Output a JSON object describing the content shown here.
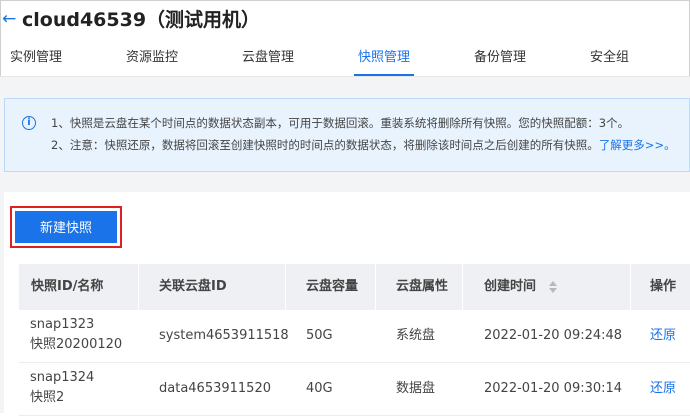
{
  "header": {
    "back_icon": "back-arrow-icon",
    "back_glyph": "←",
    "title": "cloud46539（测试用机）"
  },
  "tabs": [
    {
      "label": "实例管理",
      "active": false
    },
    {
      "label": "资源监控",
      "active": false
    },
    {
      "label": "云盘管理",
      "active": false
    },
    {
      "label": "快照管理",
      "active": true
    },
    {
      "label": "备份管理",
      "active": false
    },
    {
      "label": "安全组",
      "active": false
    }
  ],
  "notice": {
    "icon": "info-icon",
    "line1": "1、快照是云盘在某个时间点的数据状态副本，可用于数据回滚。重装系统将删除所有快照。您的快照配额：3个。",
    "line2": "2、注意：快照还原，数据将回滚至创建快照时的时间点的数据状态，将删除该时间点之后创建的所有快照。",
    "link": "了解更多>>。"
  },
  "toolbar": {
    "create_label": "新建快照"
  },
  "table": {
    "columns": [
      "快照ID/名称",
      "关联云盘ID",
      "云盘容量",
      "云盘属性",
      "创建时间",
      "操作"
    ],
    "sort_icon": "sort-icon",
    "rows": [
      {
        "id": "snap1323",
        "name": "快照20200120",
        "disk_id": "system4653911518",
        "capacity": "50G",
        "attr": "系统盘",
        "created": "2022-01-20 09:24:48",
        "action": "还原"
      },
      {
        "id": "snap1324",
        "name": "快照2",
        "disk_id": "data4653911520",
        "capacity": "40G",
        "attr": "数据盘",
        "created": "2022-01-20 09:30:14",
        "action": "还原"
      }
    ]
  },
  "colors": {
    "accent": "#1a73e8",
    "highlight_border": "#e02020",
    "notice_bg": "#e8f3fe"
  }
}
